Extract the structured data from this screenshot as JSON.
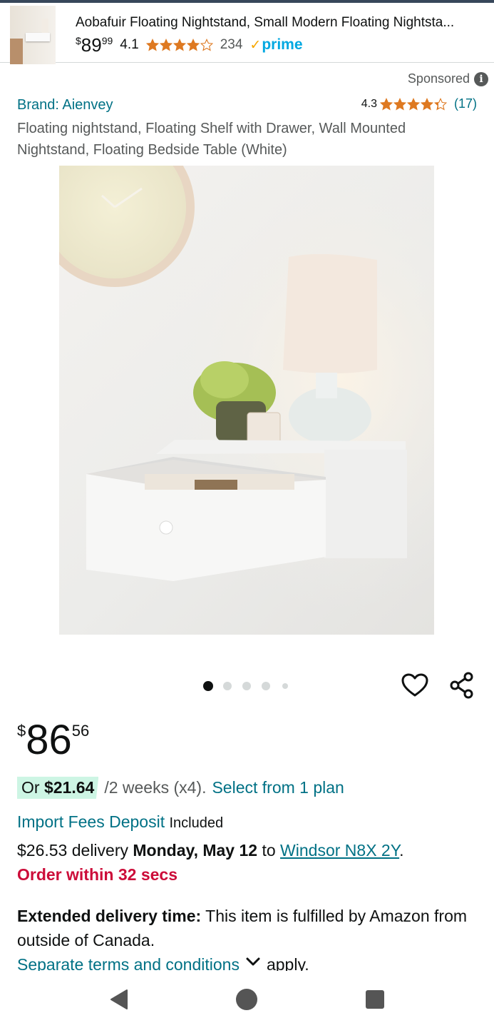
{
  "sticky": {
    "title": "Aobafuir Floating Nightstand, Small Modern Floating Nightsta...",
    "price_whole": "89",
    "price_frac": "99",
    "currency": "$",
    "rating": "4.1",
    "rating_value": 4.1,
    "review_count": "234",
    "prime_label": "prime"
  },
  "ad": {
    "sponsored_label": "Sponsored",
    "info_icon": "i",
    "brand": "Brand: Aienvey",
    "rating": "4.3",
    "rating_value": 4.3,
    "review_count": "(17)",
    "title": "Floating nightstand, Floating Shelf with Drawer, Wall Mounted Nightstand, Floating Bedside Table (White)"
  },
  "gallery": {
    "image_count": 5,
    "active_index": 0
  },
  "actions": {
    "wishlist_icon": "heart-icon",
    "share_icon": "share-icon"
  },
  "price": {
    "currency": "$",
    "whole": "86",
    "frac": "56"
  },
  "installments": {
    "prefix": "Or ",
    "amount": "$21.64",
    "term": "/2 weeks (x4).",
    "link": "Select from 1 plan"
  },
  "import_fees": {
    "link": "Import Fees Deposit",
    "status": "Included"
  },
  "delivery": {
    "cost": "$26.53 delivery ",
    "date": "Monday, May 12",
    "to": " to ",
    "location": "Windsor N8X 2Y",
    "end": "."
  },
  "order_within": "Order within 32 secs",
  "extended": {
    "label": "Extended delivery time:",
    "text": " This item is fulfilled by Amazon from outside of Canada."
  },
  "terms": {
    "link": "Separate terms and conditions",
    "suffix": "apply."
  },
  "colors": {
    "link": "#007185",
    "star": "#de7921",
    "prime": "#00a8e1",
    "urgent": "#cc0c39",
    "installment_bg": "#cdf5e4"
  },
  "nav": {
    "back_icon": "back-triangle-icon",
    "home_icon": "home-circle-icon",
    "recents_icon": "recents-square-icon"
  }
}
